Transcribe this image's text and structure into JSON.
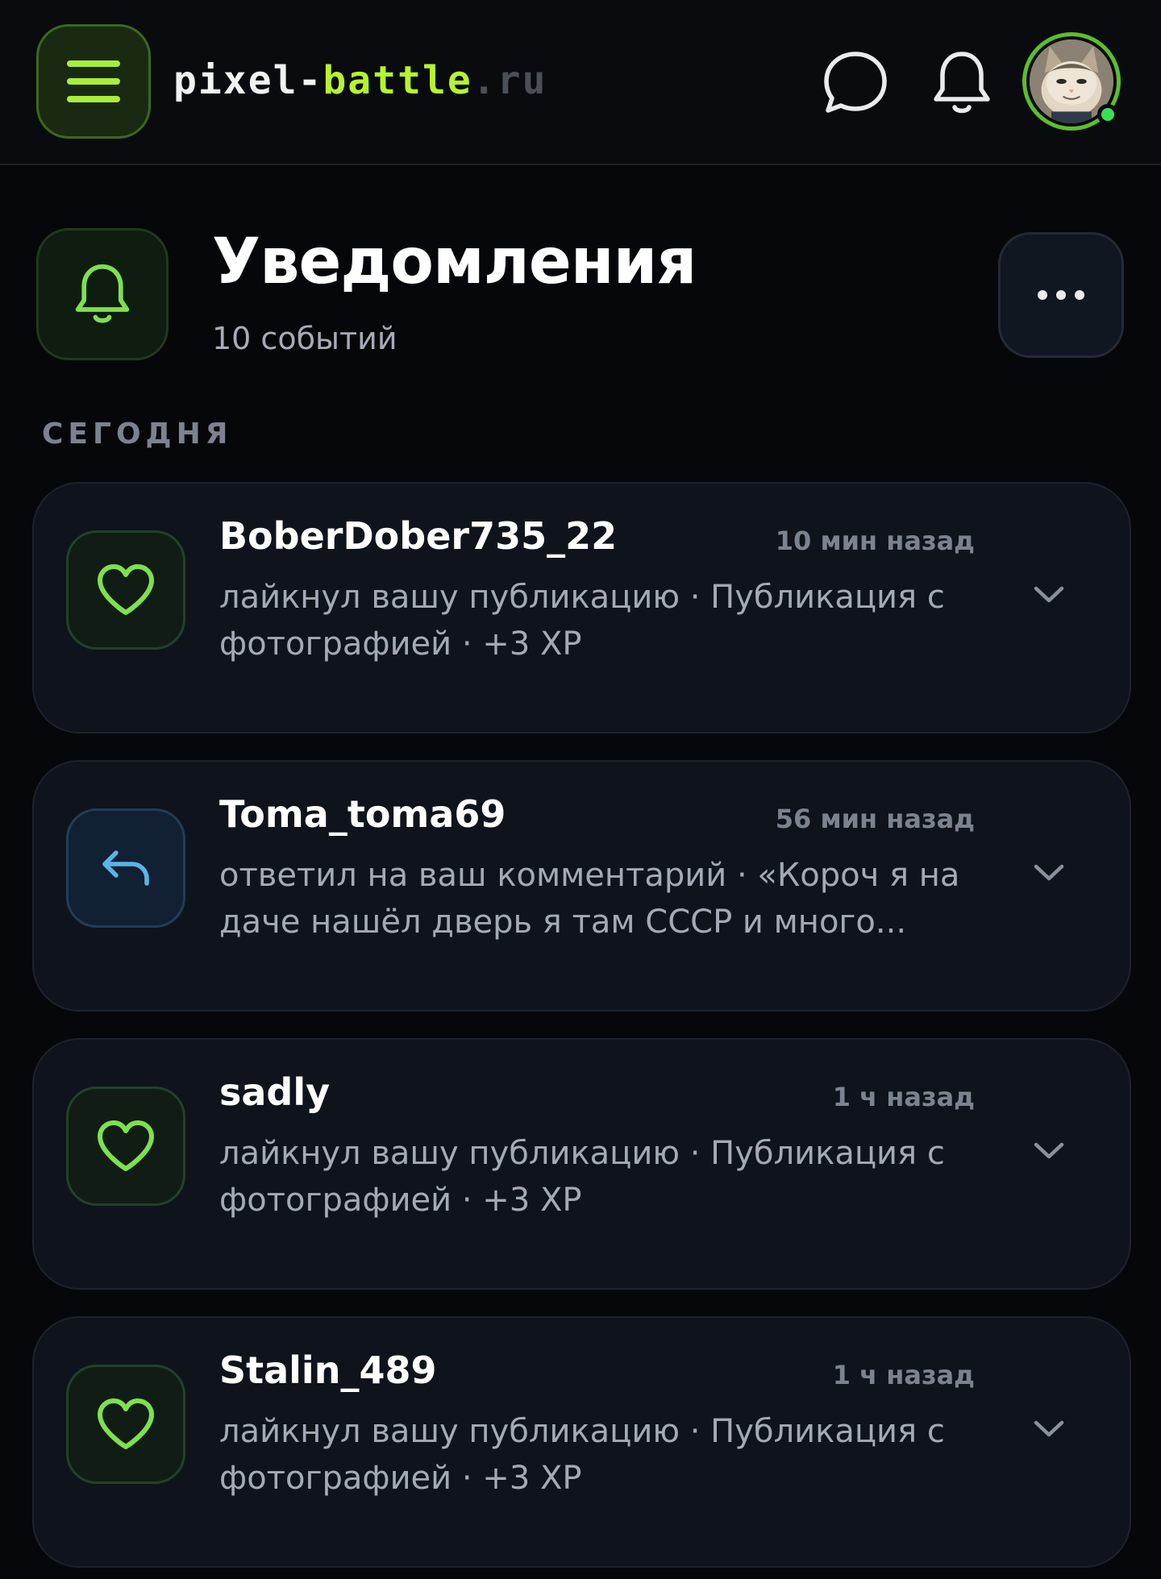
{
  "header": {
    "logo_part1": "pixel-",
    "logo_part2": "battle",
    "logo_part3": ".ru",
    "menu_icon": "hamburger-icon",
    "chat_icon": "chat-bubble-icon",
    "bell_icon": "bell-icon",
    "avatar": "user-avatar-cat",
    "online_status_color": "#38e05a"
  },
  "page": {
    "title": "Уведомления",
    "subtitle": "10 событий",
    "more_icon": "more-dots-icon"
  },
  "section": {
    "label": "СЕГОДНЯ"
  },
  "notifications": [
    {
      "type": "like",
      "icon": "heart-icon",
      "user": "BoberDober735_22",
      "time": "10 мин назад",
      "text": "лайкнул вашу публикацию · Публикация с фотографией · +3 XP"
    },
    {
      "type": "reply",
      "icon": "reply-arrow-icon",
      "user": "Toma_toma69",
      "time": "56 мин назад",
      "text": "ответил на ваш комментарий · «Короч я на даче нашёл дверь я там СССР и много..."
    },
    {
      "type": "like",
      "icon": "heart-icon",
      "user": "sadly",
      "time": "1 ч назад",
      "text": "лайкнул вашу публикацию · Публикация с фотографией · +3 XP"
    },
    {
      "type": "like",
      "icon": "heart-icon",
      "user": "Stalin_489",
      "time": "1 ч назад",
      "text": "лайкнул вашу публикацию · Публикация с фотографией · +3 XP"
    }
  ],
  "colors": {
    "accent_green": "#b6f42c",
    "like_green": "#7fe04e",
    "reply_blue": "#5ab4e6",
    "background": "#06070a",
    "card_bg": "#0f141c"
  }
}
